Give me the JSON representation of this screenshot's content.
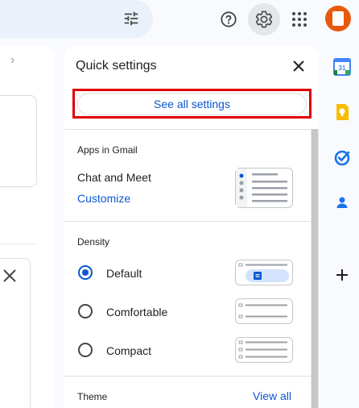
{
  "header": {
    "icons": [
      "tune-icon",
      "help-icon",
      "gear-icon",
      "apps-icon",
      "avatar"
    ],
    "accent": "#0b57d0"
  },
  "quick_settings": {
    "title": "Quick settings",
    "see_all_label": "See all settings",
    "apps_section": {
      "label": "Apps in Gmail",
      "value": "Chat and Meet",
      "customize_label": "Customize"
    },
    "density": {
      "label": "Density",
      "options": [
        {
          "label": "Default",
          "selected": true
        },
        {
          "label": "Comfortable",
          "selected": false
        },
        {
          "label": "Compact",
          "selected": false
        }
      ]
    },
    "theme": {
      "label": "Theme",
      "view_all_label": "View all"
    }
  },
  "side_rail": {
    "icons": [
      "calendar-icon",
      "keep-icon",
      "tasks-icon",
      "contacts-icon",
      "add-icon"
    ],
    "calendar_day": "31"
  },
  "highlight_color": "#e00000"
}
